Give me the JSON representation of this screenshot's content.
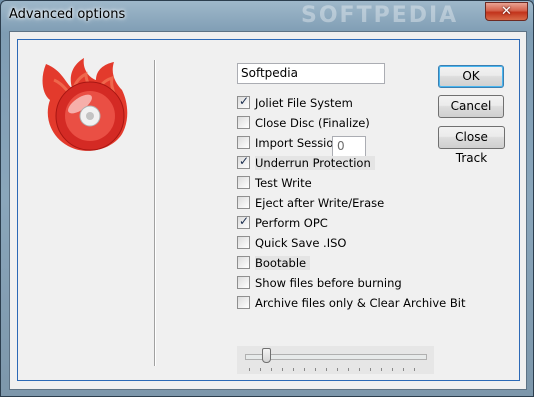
{
  "window": {
    "title": "Advanced options",
    "close_glyph": "✕"
  },
  "watermark": "SOFTPEDIA",
  "fields": {
    "name_value": "Softpedia",
    "session_value": "0"
  },
  "options": [
    {
      "label": "Joliet File System",
      "checked": true
    },
    {
      "label": "Close Disc (Finalize)",
      "checked": false
    },
    {
      "label": "Import Session",
      "checked": false
    },
    {
      "label": "Underrun Protection",
      "checked": true
    },
    {
      "label": "Test Write",
      "checked": false
    },
    {
      "label": "Eject after Write/Erase",
      "checked": false
    },
    {
      "label": "Perform OPC",
      "checked": true
    },
    {
      "label": "Quick Save .ISO",
      "checked": false
    },
    {
      "label": "Bootable",
      "checked": false
    },
    {
      "label": "Show files before burning",
      "checked": false
    },
    {
      "label": "Archive files only & Clear Archive Bit",
      "checked": false
    }
  ],
  "buttons": {
    "ok": "OK",
    "cancel": "Cancel",
    "close_track": "Close Track"
  },
  "slider": {
    "value_fraction": 0.1
  },
  "colors": {
    "logo_red": "#e0302a",
    "default_border": "#3c7fb1"
  }
}
